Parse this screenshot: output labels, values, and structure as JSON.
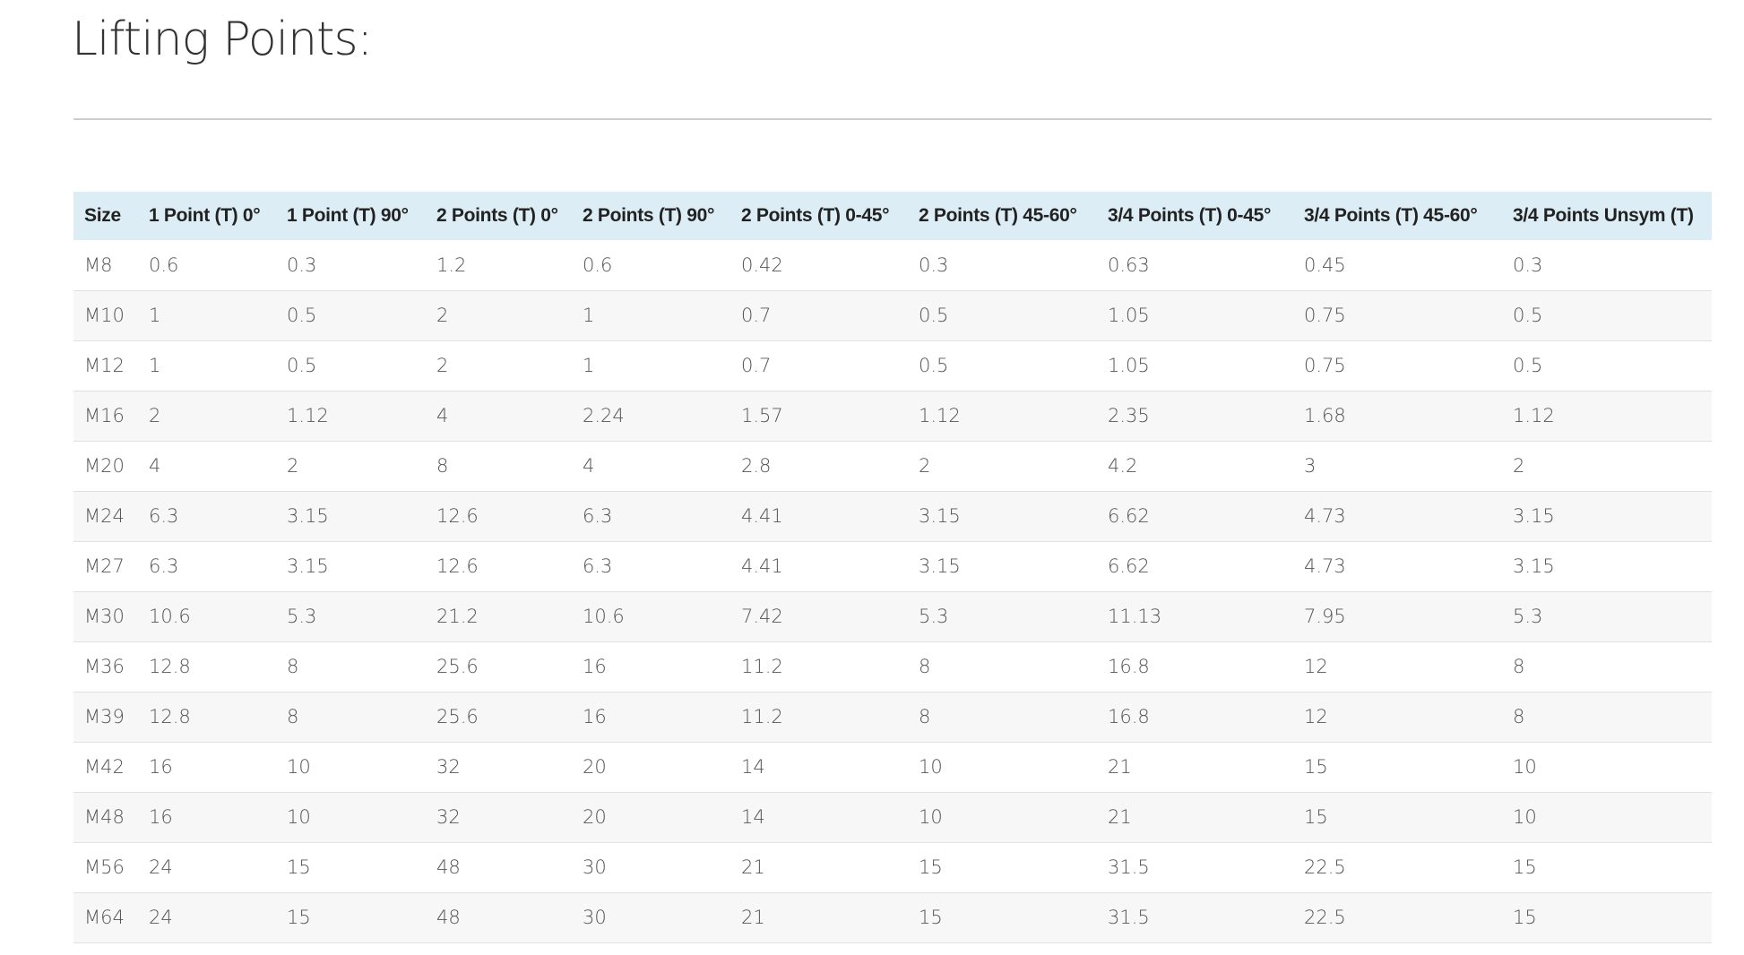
{
  "page": {
    "title": "Lifting Points:"
  },
  "table": {
    "headers": [
      "Size",
      "1 Point (T) 0°",
      "1 Point (T) 90°",
      "2 Points (T) 0°",
      "2 Points (T) 90°",
      "2 Points (T) 0-45°",
      "2 Points (T) 45-60°",
      "3/4 Points (T) 0-45°",
      "3/4 Points (T) 45-60°",
      "3/4 Points Unsym (T)"
    ],
    "rows": [
      [
        "M8",
        "0.6",
        "0.3",
        "1.2",
        "0.6",
        "0.42",
        "0.3",
        "0.63",
        "0.45",
        "0.3"
      ],
      [
        "M10",
        "1",
        "0.5",
        "2",
        "1",
        "0.7",
        "0.5",
        "1.05",
        "0.75",
        "0.5"
      ],
      [
        "M12",
        "1",
        "0.5",
        "2",
        "1",
        "0.7",
        "0.5",
        "1.05",
        "0.75",
        "0.5"
      ],
      [
        "M16",
        "2",
        "1.12",
        "4",
        "2.24",
        "1.57",
        "1.12",
        "2.35",
        "1.68",
        "1.12"
      ],
      [
        "M20",
        "4",
        "2",
        "8",
        "4",
        "2.8",
        "2",
        "4.2",
        "3",
        "2"
      ],
      [
        "M24",
        "6.3",
        "3.15",
        "12.6",
        "6.3",
        "4.41",
        "3.15",
        "6.62",
        "4.73",
        "3.15"
      ],
      [
        "M27",
        "6.3",
        "3.15",
        "12.6",
        "6.3",
        "4.41",
        "3.15",
        "6.62",
        "4.73",
        "3.15"
      ],
      [
        "M30",
        "10.6",
        "5.3",
        "21.2",
        "10.6",
        "7.42",
        "5.3",
        "11.13",
        "7.95",
        "5.3"
      ],
      [
        "M36",
        "12.8",
        "8",
        "25.6",
        "16",
        "11.2",
        "8",
        "16.8",
        "12",
        "8"
      ],
      [
        "M39",
        "12.8",
        "8",
        "25.6",
        "16",
        "11.2",
        "8",
        "16.8",
        "12",
        "8"
      ],
      [
        "M42",
        "16",
        "10",
        "32",
        "20",
        "14",
        "10",
        "21",
        "15",
        "10"
      ],
      [
        "M48",
        "16",
        "10",
        "32",
        "20",
        "14",
        "10",
        "21",
        "15",
        "10"
      ],
      [
        "M56",
        "24",
        "15",
        "48",
        "30",
        "21",
        "15",
        "31.5",
        "22.5",
        "15"
      ],
      [
        "M64",
        "24",
        "15",
        "48",
        "30",
        "21",
        "15",
        "31.5",
        "22.5",
        "15"
      ]
    ]
  },
  "colors": {
    "header_background": "#dcedf5",
    "row_alt_background": "#f7f7f7",
    "divider": "#cfcfcf"
  }
}
